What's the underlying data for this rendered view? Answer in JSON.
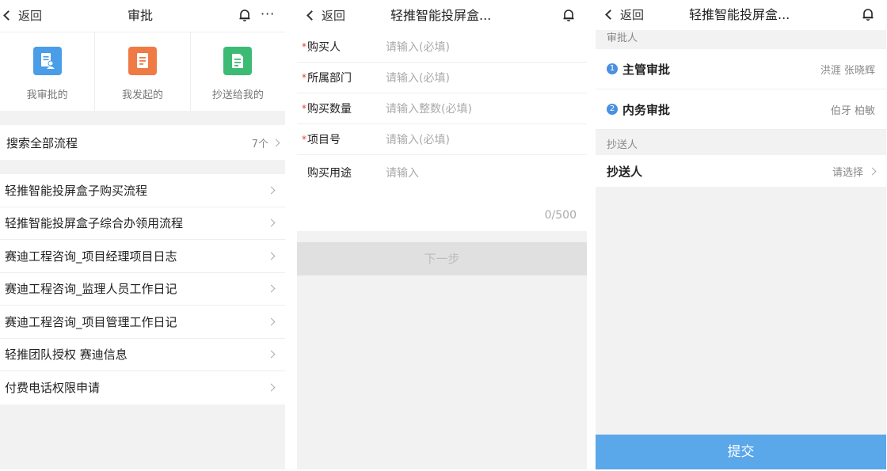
{
  "panel1": {
    "back_label": "返回",
    "title": "审批",
    "more_label": "···",
    "shortcuts": [
      {
        "label": "我审批的",
        "icon": "approve-person-icon",
        "color": "#4a9de8"
      },
      {
        "label": "我发起的",
        "icon": "document-icon",
        "color": "#f07a45"
      },
      {
        "label": "抄送给我的",
        "icon": "document-copy-icon",
        "color": "#3dbb74"
      }
    ],
    "search_label": "搜索全部流程",
    "search_count": "7个",
    "flows": [
      "轻推智能投屏盒子购买流程",
      "轻推智能投屏盒子综合办领用流程",
      "赛迪工程咨询_项目经理项目日志",
      "赛迪工程咨询_监理人员工作日记",
      "赛迪工程咨询_项目管理工作日记",
      "轻推团队授权 赛迪信息",
      "付费电话权限申请"
    ]
  },
  "panel2": {
    "back_label": "返回",
    "title": "轻推智能投屏盒...",
    "fields": [
      {
        "required": true,
        "label": "购买人",
        "placeholder": "请输入(必填)"
      },
      {
        "required": true,
        "label": "所属部门",
        "placeholder": "请输入(必填)"
      },
      {
        "required": true,
        "label": "购买数量",
        "placeholder": "请输入整数(必填)"
      },
      {
        "required": true,
        "label": "项目号",
        "placeholder": "请输入(必填)"
      }
    ],
    "purpose": {
      "label": "购买用途",
      "placeholder": "请输入",
      "counter": "0/500"
    },
    "next_label": "下一步",
    "required_mark": "*"
  },
  "panel3": {
    "back_label": "返回",
    "title": "轻推智能投屏盒...",
    "approvers_header": "审批人",
    "approvers": [
      {
        "num": "1",
        "name": "主管审批",
        "people": "洪涯 张晓辉"
      },
      {
        "num": "2",
        "name": "内务审批",
        "people": "伯牙 柏敏"
      }
    ],
    "cc_header": "抄送人",
    "cc_label": "抄送人",
    "cc_choose": "请选择",
    "submit_label": "提交"
  },
  "colors": {
    "accent": "#5aa7e9",
    "required": "#e43d33"
  }
}
